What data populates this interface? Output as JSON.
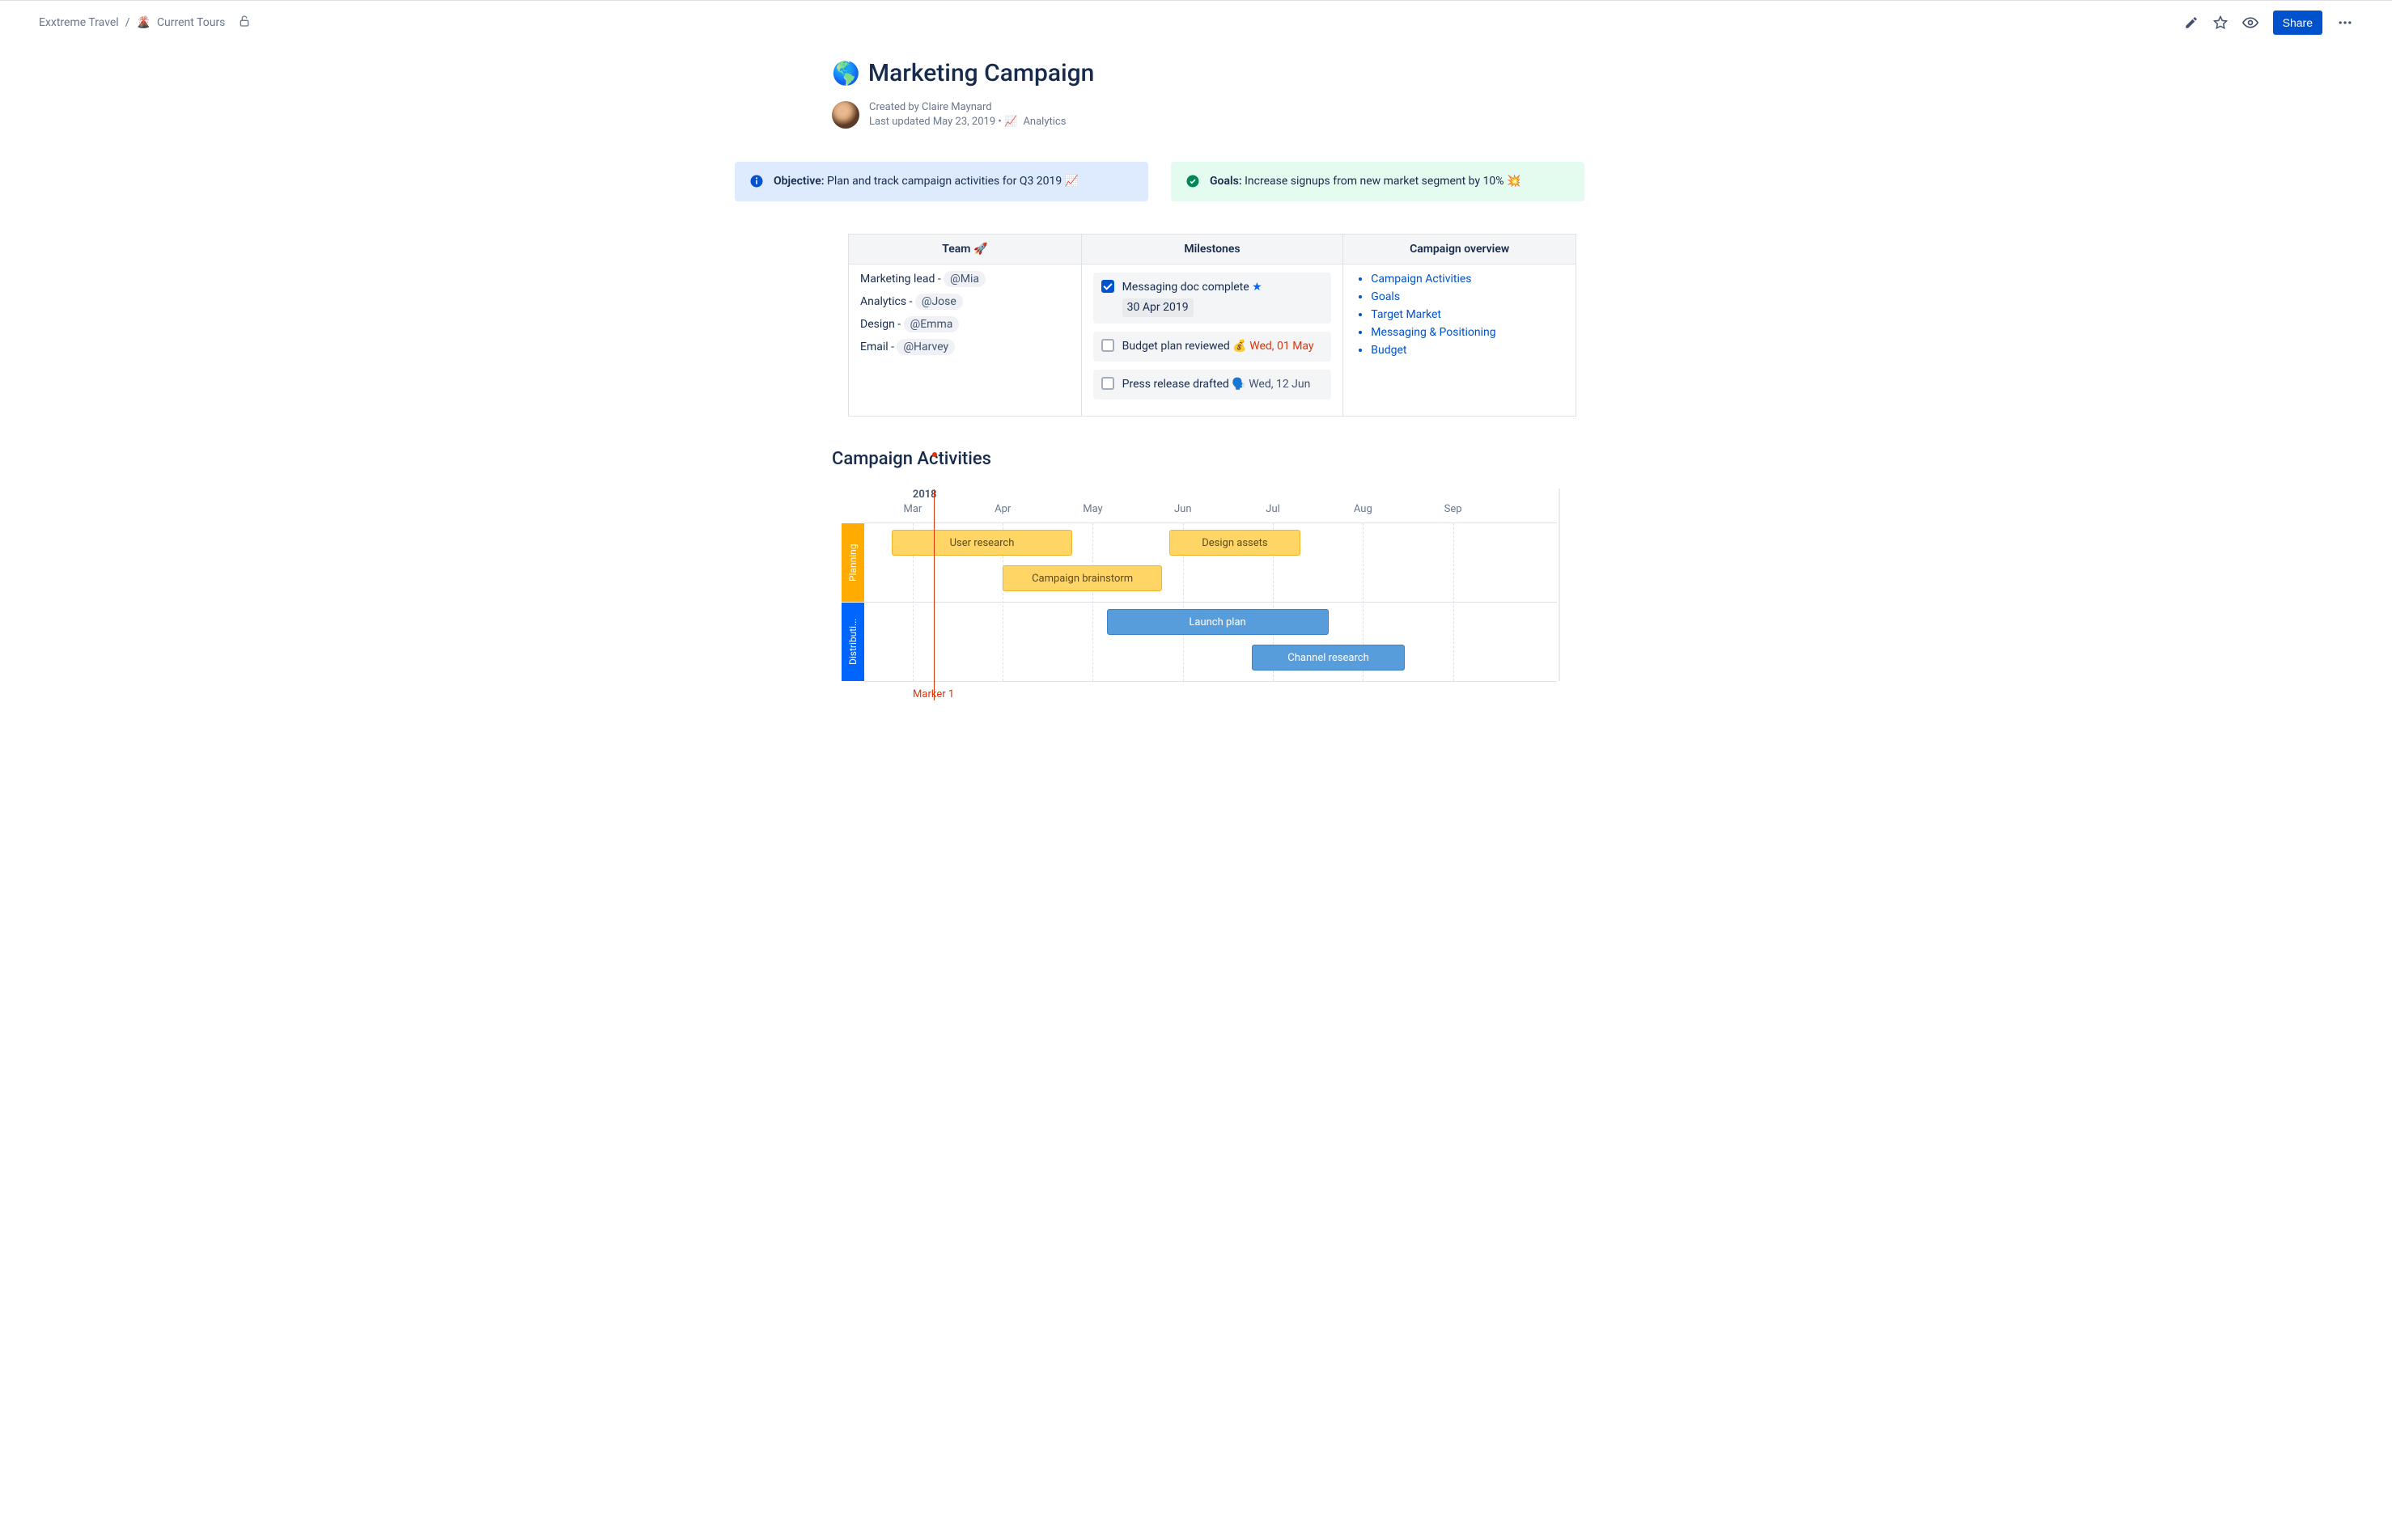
{
  "breadcrumb": {
    "space": "Exxtreme Travel",
    "page_icon": "🌋",
    "page": "Current Tours"
  },
  "share_button": "Share",
  "title": {
    "emoji": "🌎",
    "text": "Marketing Campaign"
  },
  "byline": {
    "created_by": "Created by Claire Maynard",
    "updated": "Last updated May 23, 2019",
    "analytics": "Analytics"
  },
  "panels": {
    "objective_label": "Objective:",
    "objective_text": " Plan and track campaign activities for Q3 2019 📈",
    "goals_label": "Goals:",
    "goals_text": " Increase signups from new market segment by 10% 💥"
  },
  "table": {
    "headers": {
      "team": "Team 🚀",
      "milestones": "Milestones",
      "overview": "Campaign overview"
    },
    "team": [
      {
        "role": "Marketing lead - ",
        "mention": "@Mia"
      },
      {
        "role": "Analytics - ",
        "mention": "@Jose"
      },
      {
        "role": "Design - ",
        "mention": "@Emma"
      },
      {
        "role": "Email - ",
        "mention": "@Harvey"
      }
    ],
    "milestones": [
      {
        "done": true,
        "text": "Messaging doc complete ",
        "icon": "⭐",
        "date": "30 Apr 2019",
        "date_style": "chip"
      },
      {
        "done": false,
        "text": "Budget plan reviewed ",
        "icon": "💰",
        "date": "Wed, 01 May",
        "date_style": "red"
      },
      {
        "done": false,
        "text": "Press release drafted ",
        "icon": "🗣️",
        "date": "Wed, 12 Jun",
        "date_style": "dark"
      }
    ],
    "overview": [
      "Campaign Activities",
      "Goals",
      "Target Market",
      "Messaging & Positioning",
      "Budget"
    ]
  },
  "gantt": {
    "title": "Campaign Activities",
    "year": "2018",
    "months": [
      "Mar",
      "Apr",
      "May",
      "Jun",
      "Jul",
      "Aug",
      "Sep"
    ],
    "marker": "Marker 1",
    "lanes": {
      "planning": "Planning",
      "distribution": "Distributi..."
    },
    "bars": {
      "user_research": "User research",
      "design_assets": "Design assets",
      "campaign_brainstorm": "Campaign brainstorm",
      "launch_plan": "Launch plan",
      "channel_research": "Channel research"
    }
  },
  "chart_data": {
    "type": "gantt",
    "year": 2018,
    "x_ticks": [
      "Mar",
      "Apr",
      "May",
      "Jun",
      "Jul",
      "Aug",
      "Sep"
    ],
    "marker": {
      "label": "Marker 1",
      "position_month_fraction": 0.5,
      "reference_month": "Mar"
    },
    "swimlanes": [
      {
        "name": "Planning",
        "color": "#FFD666",
        "tasks": [
          {
            "name": "User research",
            "start": "Mar",
            "end": "May"
          },
          {
            "name": "Design assets",
            "start": "Jun",
            "end": "Jul"
          },
          {
            "name": "Campaign brainstorm",
            "start": "Apr",
            "end": "May"
          }
        ]
      },
      {
        "name": "Distribution",
        "color": "#579DDB",
        "tasks": [
          {
            "name": "Launch plan",
            "start": "May",
            "end": "Jul"
          },
          {
            "name": "Channel research",
            "start": "Jul",
            "end": "Aug"
          }
        ]
      }
    ]
  }
}
